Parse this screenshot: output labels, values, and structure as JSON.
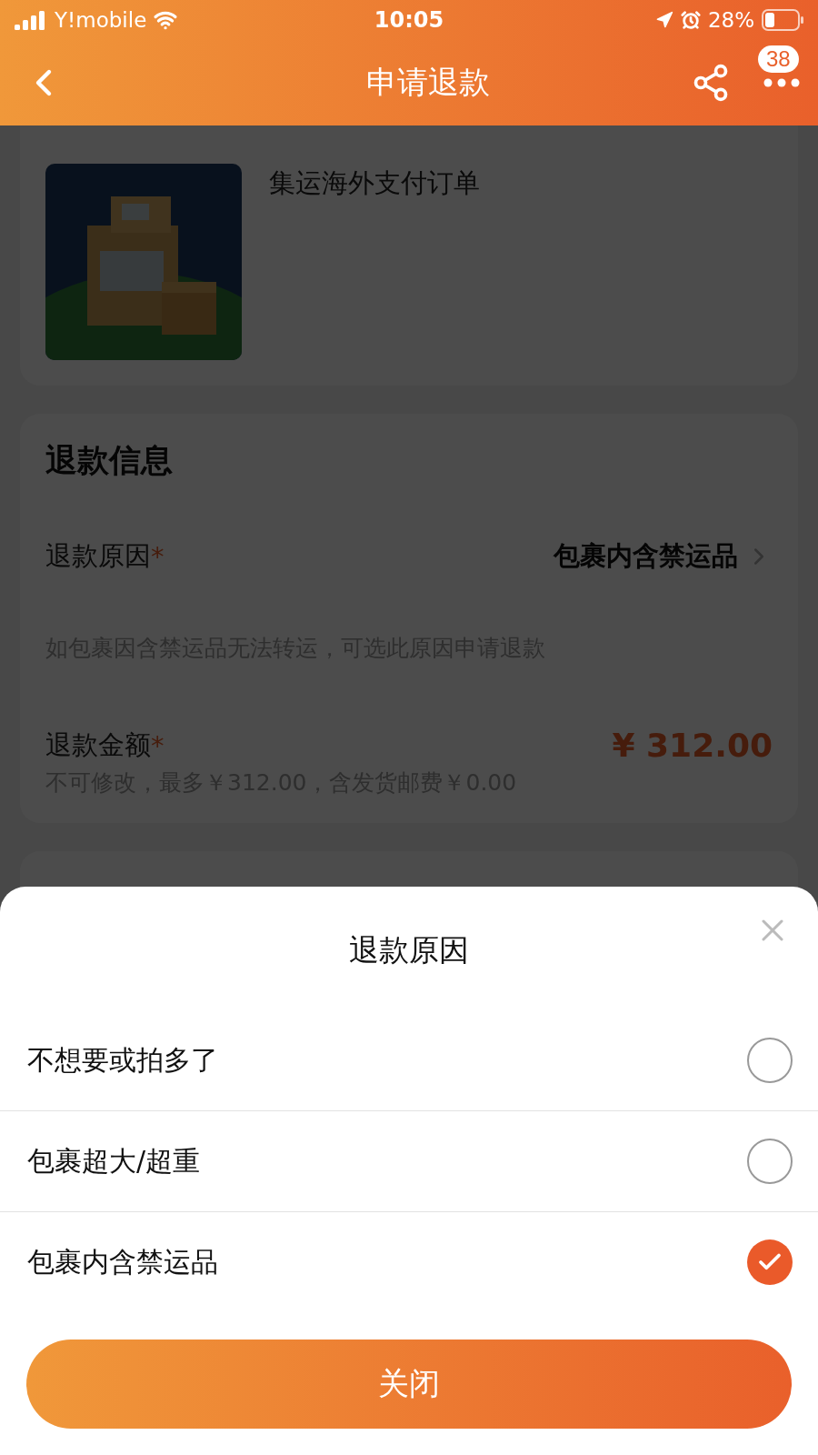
{
  "status_bar": {
    "carrier": "Y!mobile",
    "time": "10:05",
    "battery": "28%"
  },
  "nav": {
    "title": "申请退款",
    "badge": "38"
  },
  "product": {
    "name": "集运海外支付订单"
  },
  "refund_info": {
    "title": "退款信息",
    "reason_label": "退款原因",
    "reason_required": "*",
    "reason_value": "包裹内含禁运品",
    "hint": "如包裹因含禁运品无法转运，可选此原因申请退款",
    "amount_label": "退款金额",
    "amount_required": "*",
    "amount": "¥ 312.00",
    "amount_note": "不可修改，最多￥312.00，含发货邮费￥0.00"
  },
  "sheet": {
    "title": "退款原因",
    "options": [
      {
        "label": "不想要或拍多了",
        "selected": false
      },
      {
        "label": "包裹超大/超重",
        "selected": false
      },
      {
        "label": "包裹内含禁运品",
        "selected": true
      }
    ],
    "close_button": "关闭"
  }
}
